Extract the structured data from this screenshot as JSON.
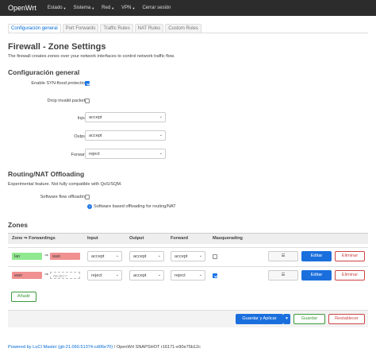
{
  "topbar": {
    "brand": "OpenWrt",
    "menu": [
      "Estado",
      "Sistema",
      "Red",
      "VPN"
    ],
    "logout": "Cerrar sesión"
  },
  "tabs": [
    "Configuración general",
    "Port Forwards",
    "Traffic Rules",
    "NAT Rules",
    "Custom Rules"
  ],
  "page": {
    "title": "Firewall - Zone Settings",
    "description": "The firewall creates zones over your network interfaces to control network traffic flow."
  },
  "general": {
    "heading": "Configuración general",
    "syn_label": "Enable SYN-flood protection",
    "drop_label": "Drop invalid packets",
    "input_label": "Input",
    "input_value": "accept",
    "output_label": "Output",
    "output_value": "accept",
    "forward_label": "Forward",
    "forward_value": "reject"
  },
  "offload": {
    "heading": "Routing/NAT Offloading",
    "description": "Experimental feature. Not fully compatible with QoS/SQM.",
    "sw_label": "Software flow offloading",
    "sw_hint": "Software based offloading for routing/NAT"
  },
  "zones": {
    "heading": "Zones",
    "columns": {
      "zone": "Zone ⇒ Forwardings",
      "input": "Input",
      "output": "Output",
      "forward": "Forward",
      "masq": "Masquerading"
    },
    "rows": [
      {
        "src": "lan",
        "dst": "wan",
        "input": "accept",
        "output": "accept",
        "forward": "accept",
        "masq": false,
        "edit": "Editar",
        "delete": "Eliminar"
      },
      {
        "src": "wan",
        "dst": "REJECT",
        "input": "reject",
        "output": "accept",
        "forward": "reject",
        "masq": true,
        "edit": "Editar",
        "delete": "Eliminar"
      }
    ],
    "add_button": "Añadir"
  },
  "actions": {
    "save_apply": "Guardar y Aplicar",
    "save": "Guardar",
    "reset": "Restablecer"
  },
  "footer": {
    "link": "Powered by LuCI Master (git-21.060.51374-cd06e70)",
    "rest": " / OpenWrt SNAPSHOT r16171-e90e75b12c"
  },
  "colors": {
    "lan": "#90e890",
    "wan": "#f09090",
    "primary": "#1a6fdd"
  }
}
